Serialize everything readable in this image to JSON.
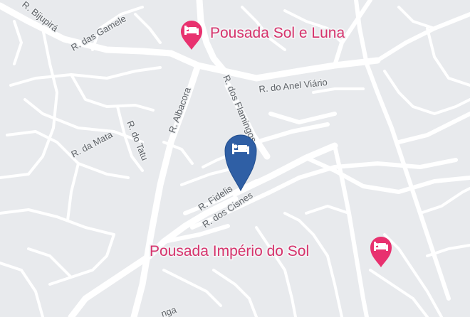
{
  "map": {
    "streets": [
      {
        "id": "bijupira",
        "label": "R. Bijupirá"
      },
      {
        "id": "gameleira",
        "label": "R. das Gamele"
      },
      {
        "id": "anel-viario",
        "label": "R. do Anel Viário"
      },
      {
        "id": "flamingos",
        "label": "R. dos Flamingos"
      },
      {
        "id": "albacora",
        "label": "R. Albacora"
      },
      {
        "id": "mata",
        "label": "R. da Mata"
      },
      {
        "id": "tatu",
        "label": "R. do Tatu"
      },
      {
        "id": "fidelis",
        "label": "R. Fidelis"
      },
      {
        "id": "cisnes",
        "label": "R. dos Cisnes"
      },
      {
        "id": "partial-bottom",
        "label": "nga"
      }
    ],
    "pois": [
      {
        "id": "pousada-sol-e-luna",
        "label": "Pousada Sol e Luna",
        "icon": "hotel-bed-icon",
        "color": "#e8316f"
      },
      {
        "id": "pousada-imperio-do-sol",
        "label": "Pousada Império do Sol",
        "icon": "hotel-bed-icon",
        "color": "#e8316f"
      }
    ],
    "selected_marker": {
      "icon": "hotel-bed-icon",
      "color": "#2f5fa5"
    },
    "colors": {
      "background": "#e8eaed",
      "road": "#ffffff",
      "poi_text": "#d6336c",
      "street_text": "#5f6368"
    }
  }
}
